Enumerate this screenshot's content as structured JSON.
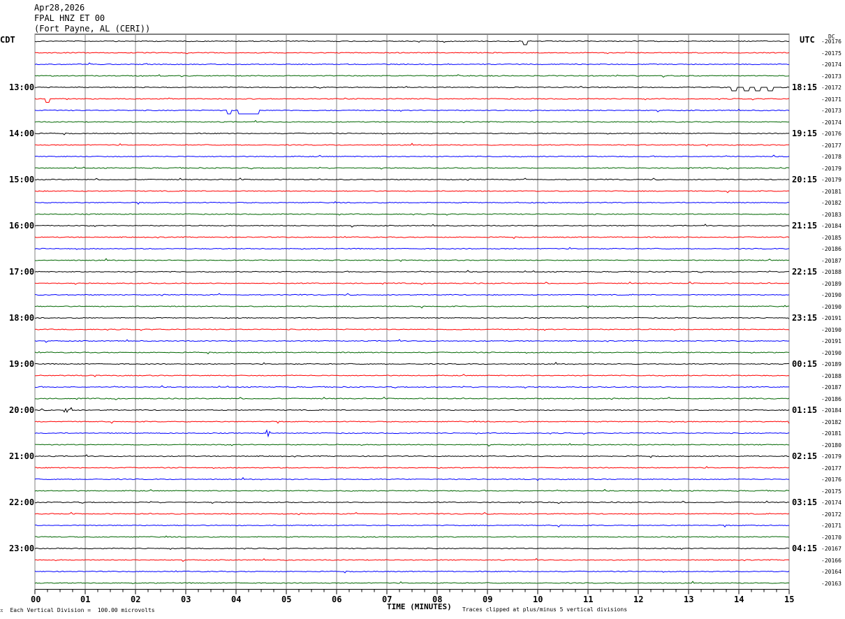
{
  "header": {
    "date": "Apr28,2026",
    "station": "FPAL HNZ ET 00",
    "location": "(Fort Payne, AL (CERI))"
  },
  "left_axis_label": "CDT",
  "right_axis_label": "UTC",
  "dc_label": "DC",
  "footer": {
    "scale_note": "Each Vertical Division =  100.00 microvolts",
    "clip_note": "Traces clipped at plus/minus 5 vertical divisions"
  },
  "colors": {
    "black": "#000000",
    "red": "#ff0000",
    "blue": "#0000ff",
    "green": "#006600",
    "grid": "#808080"
  },
  "chart_data": {
    "type": "line",
    "title": "",
    "xlabel": "TIME (MINUTES)",
    "ylabel": "",
    "xlim": [
      0,
      15
    ],
    "x_ticks": [
      "00",
      "01",
      "02",
      "03",
      "04",
      "05",
      "06",
      "07",
      "08",
      "09",
      "10",
      "11",
      "12",
      "13",
      "14",
      "15"
    ],
    "trace_count": 48,
    "trace_minutes": 15,
    "trace_colors": [
      "black",
      "red",
      "blue",
      "green"
    ],
    "left_time_labels": [
      {
        "trace": 4,
        "label": "13:00"
      },
      {
        "trace": 8,
        "label": "14:00"
      },
      {
        "trace": 12,
        "label": "15:00"
      },
      {
        "trace": 16,
        "label": "16:00"
      },
      {
        "trace": 20,
        "label": "17:00"
      },
      {
        "trace": 24,
        "label": "18:00"
      },
      {
        "trace": 28,
        "label": "19:00"
      },
      {
        "trace": 32,
        "label": "20:00"
      },
      {
        "trace": 36,
        "label": "21:00"
      },
      {
        "trace": 40,
        "label": "22:00"
      },
      {
        "trace": 44,
        "label": "23:00"
      }
    ],
    "right_time_labels": [
      {
        "trace": 4,
        "label": "18:15"
      },
      {
        "trace": 8,
        "label": "19:15"
      },
      {
        "trace": 12,
        "label": "20:15"
      },
      {
        "trace": 16,
        "label": "21:15"
      },
      {
        "trace": 20,
        "label": "22:15"
      },
      {
        "trace": 24,
        "label": "23:15"
      },
      {
        "trace": 28,
        "label": "00:15"
      },
      {
        "trace": 32,
        "label": "01:15"
      },
      {
        "trace": 36,
        "label": "02:15"
      },
      {
        "trace": 40,
        "label": "03:15"
      },
      {
        "trace": 44,
        "label": "04:15"
      }
    ],
    "dc_offsets": [
      "-20176",
      "-20175",
      "-20174",
      "-20173",
      "-20172",
      "-20171",
      "-20173",
      "-20174",
      "-20176",
      "-20177",
      "-20178",
      "-20179",
      "-20179",
      "-20181",
      "-20182",
      "-20183",
      "-20184",
      "-20185",
      "-20186",
      "-20187",
      "-20188",
      "-20189",
      "-20190",
      "-20190",
      "-20191",
      "-20190",
      "-20191",
      "-20190",
      "-20189",
      "-20188",
      "-20187",
      "-20186",
      "-20184",
      "-20182",
      "-20181",
      "-20180",
      "-20179",
      "-20177",
      "-20176",
      "-20175",
      "-20174",
      "-20172",
      "-20171",
      "-20170",
      "-20167",
      "-20166",
      "-20164",
      "-20163"
    ],
    "events": [
      {
        "trace": 0,
        "minute": 9.72,
        "duration": 0.08,
        "kind": "dip"
      },
      {
        "trace": 4,
        "minute": 13.85,
        "duration": 0.95,
        "kind": "square"
      },
      {
        "trace": 5,
        "minute": 0.22,
        "duration": 0.06,
        "kind": "dip"
      },
      {
        "trace": 6,
        "minute": 3.82,
        "duration": 0.08,
        "kind": "dip"
      },
      {
        "trace": 6,
        "minute": 4.05,
        "duration": 0.42,
        "kind": "step"
      },
      {
        "trace": 32,
        "minute": 0.58,
        "duration": 0.15,
        "kind": "burst"
      },
      {
        "trace": 34,
        "minute": 4.6,
        "duration": 0.08,
        "kind": "burst"
      },
      {
        "trace": 33,
        "minute": 14.95,
        "duration": 0.05,
        "kind": "burst"
      }
    ]
  }
}
